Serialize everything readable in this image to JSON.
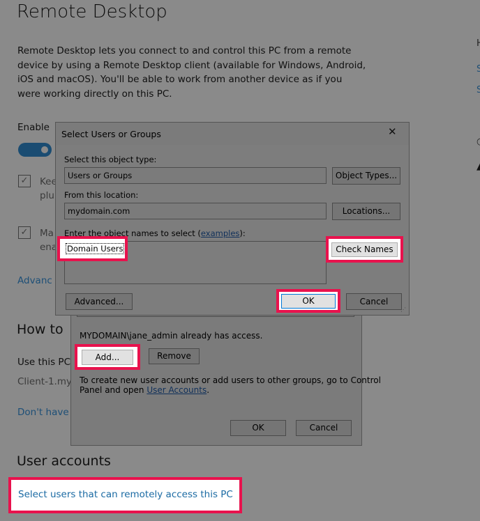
{
  "settings": {
    "title": "Remote Desktop",
    "description": "Remote Desktop lets you connect to and control this PC from a remote device by using a Remote Desktop client (available for Windows, Android, iOS and macOS). You'll be able to work from another device as if you were working directly on this PC.",
    "enable_label": "Enable",
    "keep_label_line1": "Kee",
    "keep_label_line2": "plu",
    "make_label_line1": "Ma",
    "make_label_line2": "ena",
    "advanced_link": "Advanc",
    "how_to_heading": "How to",
    "use_this_pc": "Use this PC",
    "client_name": "Client-1.my",
    "dont_have_link": "Don't have",
    "user_accounts_heading": "User accounts",
    "select_users_link": "Select users that can remotely access this PC",
    "right_edge_h": "H",
    "right_edge_s1": "S",
    "right_edge_s2": "S"
  },
  "rdu_dialog": {
    "already_access": "MYDOMAIN\\jane_admin already has access.",
    "add_button": "Add...",
    "remove_button": "Remove",
    "info_line1": "To create new user accounts or add users to other groups, go to Control",
    "info_line2_prefix": "Panel and open ",
    "user_accounts_link": "User Accounts",
    "info_line2_suffix": ".",
    "ok_button": "OK",
    "cancel_button": "Cancel"
  },
  "sug_dialog": {
    "title": "Select Users or Groups",
    "close_glyph": "✕",
    "object_type_label": "Select this object type:",
    "object_type_value": "Users or Groups",
    "object_types_button": "Object Types...",
    "location_label": "From this location:",
    "location_value": "mydomain.com",
    "locations_button": "Locations...",
    "enter_names_prefix": "Enter the object names to select (",
    "examples_link": "examples",
    "enter_names_suffix": "):",
    "names_value": "Domain Users",
    "check_names_button": "Check Names",
    "advanced_button": "Advanced...",
    "ok_button": "OK",
    "cancel_button": "Cancel"
  }
}
